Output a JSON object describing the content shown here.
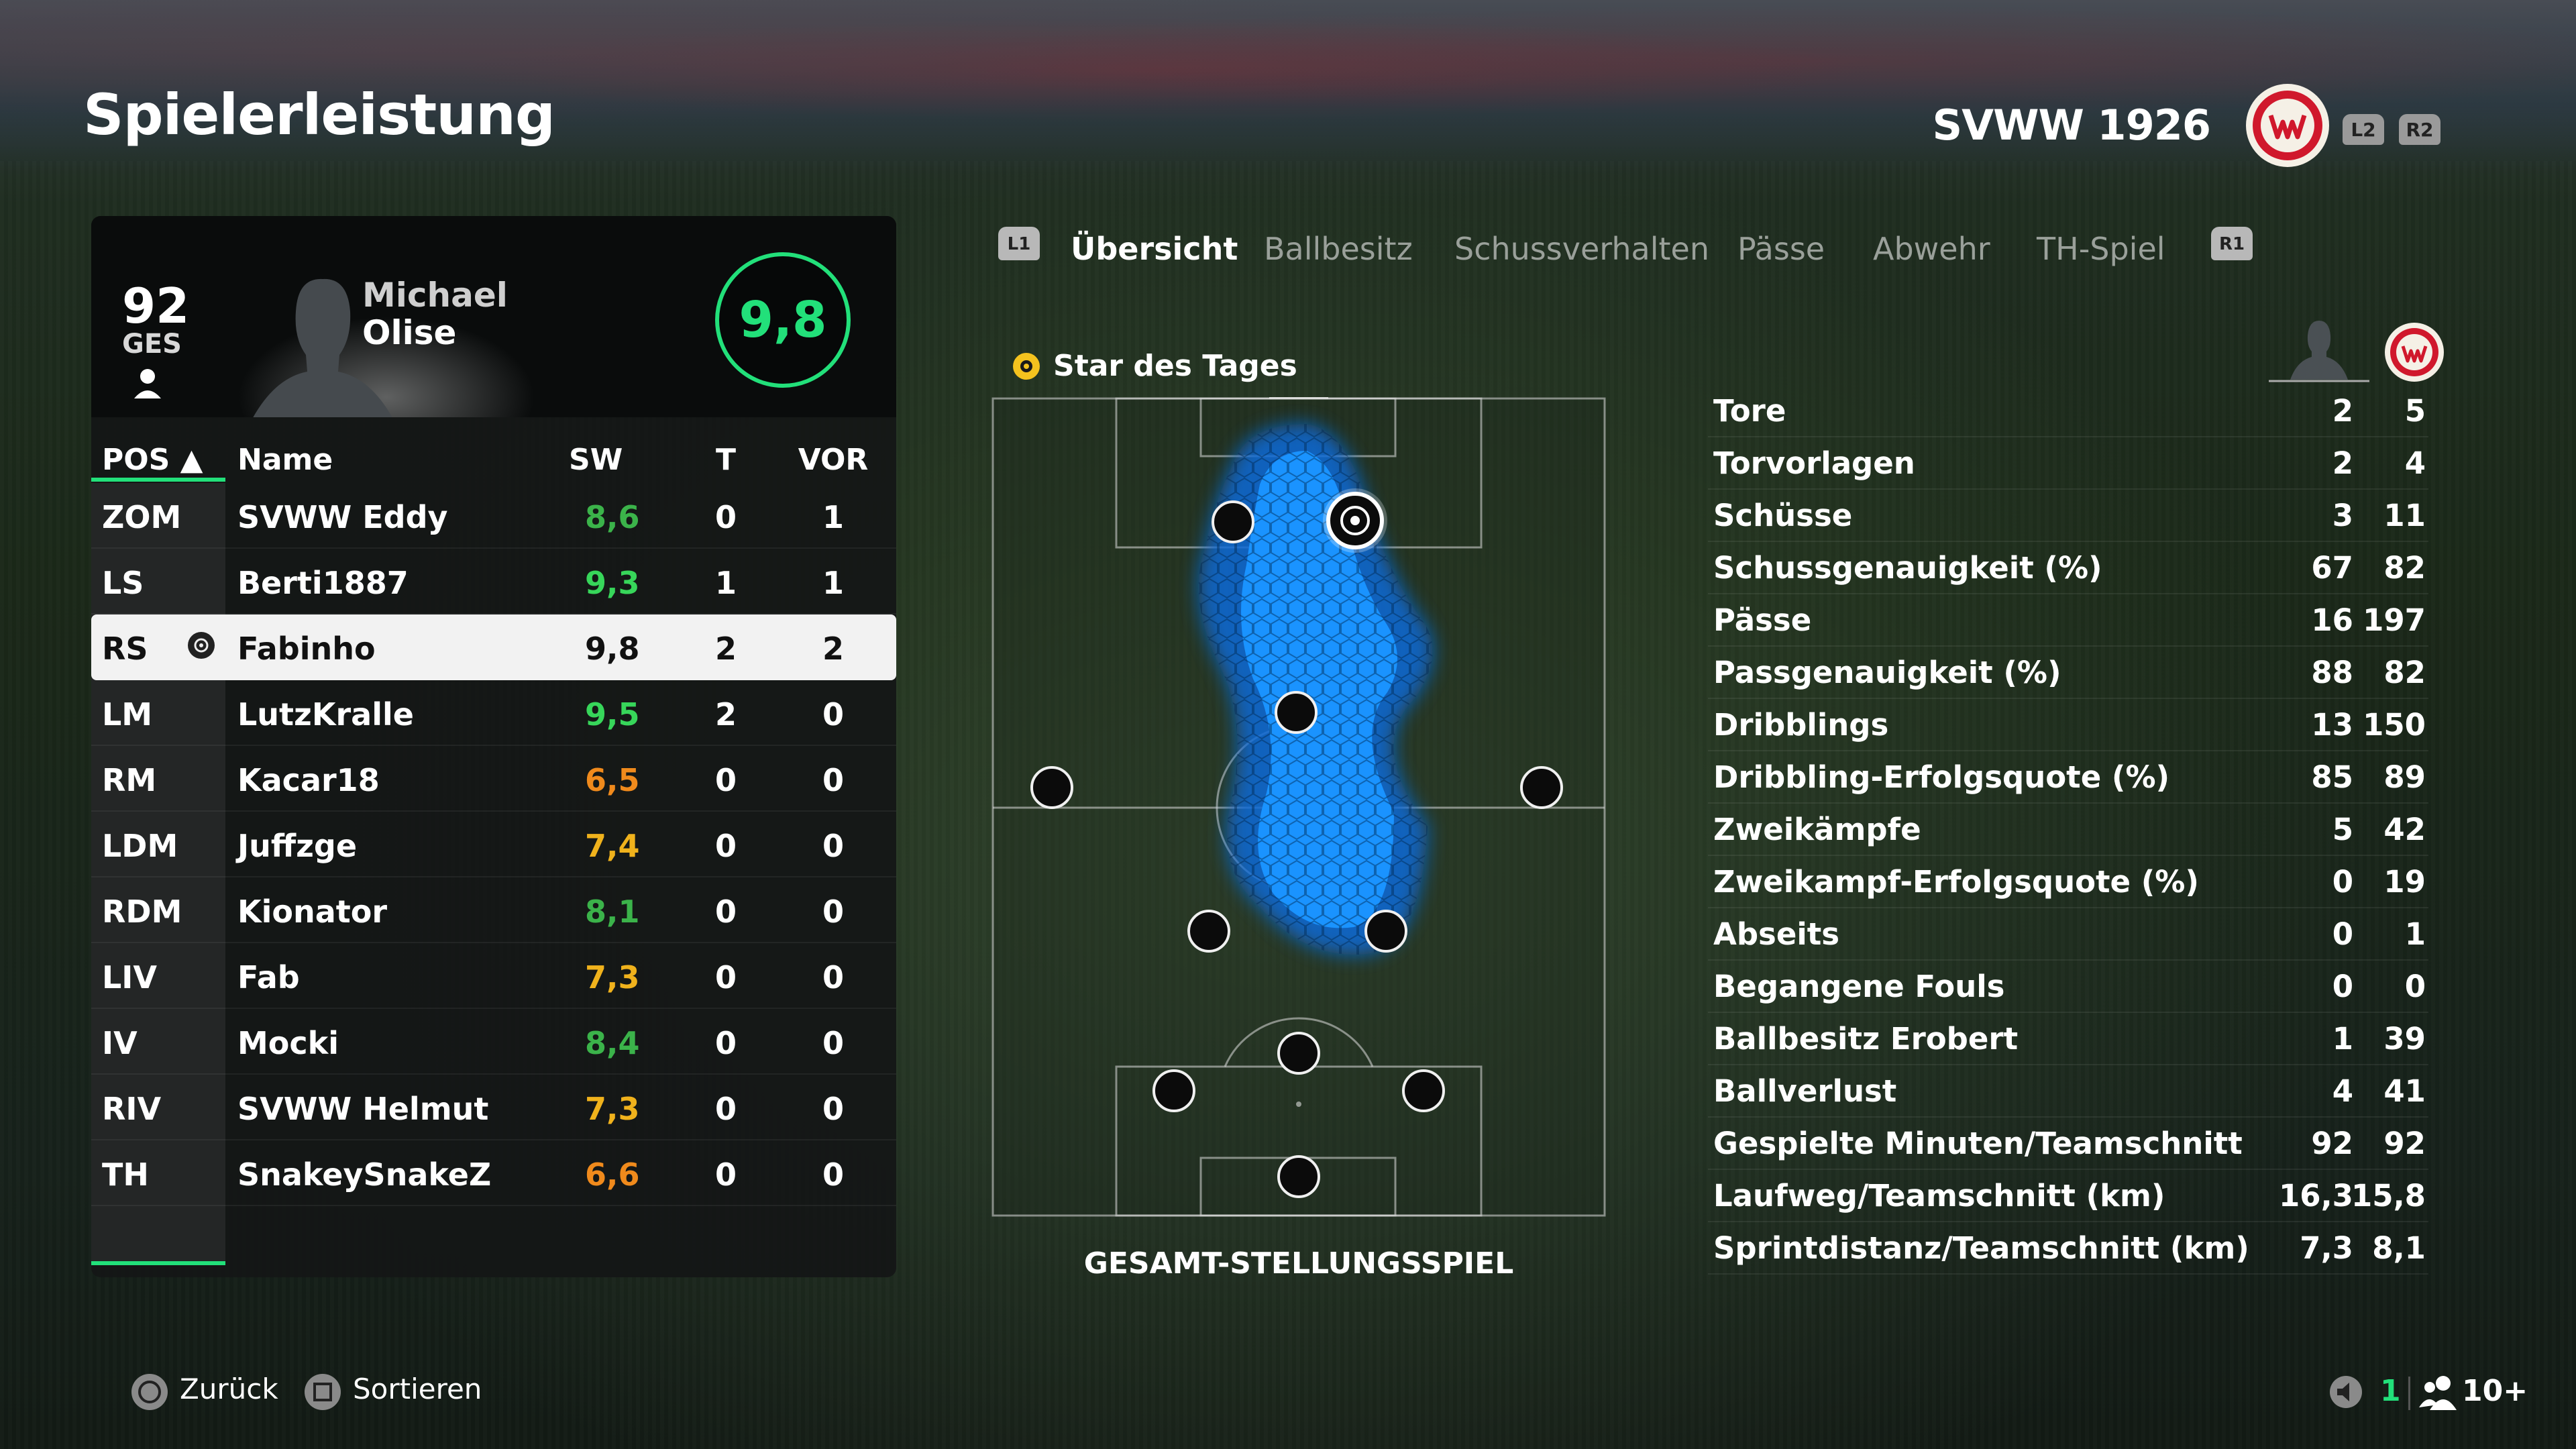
{
  "header": {
    "title": "Spielerleistung",
    "team_name": "SVWW 1926",
    "btn_l2": "L2",
    "btn_r2": "R2"
  },
  "player_card": {
    "overall": "92",
    "overall_label": "GES",
    "first_name": "Michael",
    "last_name": "Olise",
    "match_rating": "9,8",
    "rating_color": "#22e07a"
  },
  "table": {
    "headers": {
      "pos": "POS ▲",
      "name": "Name",
      "sw": "SW",
      "t": "T",
      "vor": "VOR"
    },
    "rows": [
      {
        "pos": "ZOM",
        "name": "SVWW Eddy",
        "sw": "8,6",
        "t": "0",
        "vor": "1",
        "sw_color": "#3bb34a"
      },
      {
        "pos": "LS",
        "name": "Berti1887",
        "sw": "9,3",
        "t": "1",
        "vor": "1",
        "sw_color": "#37d65a"
      },
      {
        "pos": "RS",
        "name": "Fabinho",
        "sw": "9,8",
        "t": "2",
        "vor": "2",
        "sw_color": "#111111"
      },
      {
        "pos": "LM",
        "name": "LutzKralle",
        "sw": "9,5",
        "t": "2",
        "vor": "0",
        "sw_color": "#37d65a"
      },
      {
        "pos": "RM",
        "name": "Kacar18",
        "sw": "6,5",
        "t": "0",
        "vor": "0",
        "sw_color": "#f08a1c"
      },
      {
        "pos": "LDM",
        "name": "Juffzge",
        "sw": "7,4",
        "t": "0",
        "vor": "0",
        "sw_color": "#f0b21c"
      },
      {
        "pos": "RDM",
        "name": "Kionator",
        "sw": "8,1",
        "t": "0",
        "vor": "0",
        "sw_color": "#3bb34a"
      },
      {
        "pos": "LIV",
        "name": "Fab",
        "sw": "7,3",
        "t": "0",
        "vor": "0",
        "sw_color": "#f0b21c"
      },
      {
        "pos": "IV",
        "name": "Mocki",
        "sw": "8,4",
        "t": "0",
        "vor": "0",
        "sw_color": "#3bb34a"
      },
      {
        "pos": "RIV",
        "name": "SVWW Helmut",
        "sw": "7,3",
        "t": "0",
        "vor": "0",
        "sw_color": "#f0b21c"
      },
      {
        "pos": "TH",
        "name": "SnakeySnakeZ",
        "sw": "6,6",
        "t": "0",
        "vor": "0",
        "sw_color": "#f08a1c"
      }
    ]
  },
  "tabs": {
    "left_btn": "L1",
    "right_btn": "R1",
    "items": [
      "Übersicht",
      "Ballbesitz",
      "Schussverhalten",
      "Pässe",
      "Abwehr",
      "TH-Spiel"
    ]
  },
  "star_label": "Star des Tages",
  "pitch_label": "GESAMT-STELLUNGSSPIEL",
  "stats": [
    {
      "label": "Tore",
      "player": "2",
      "team": "5"
    },
    {
      "label": "Torvorlagen",
      "player": "2",
      "team": "4"
    },
    {
      "label": "Schüsse",
      "player": "3",
      "team": "11"
    },
    {
      "label": "Schussgenauigkeit (%)",
      "player": "67",
      "team": "82"
    },
    {
      "label": "Pässe",
      "player": "16",
      "team": "197"
    },
    {
      "label": "Passgenauigkeit (%)",
      "player": "88",
      "team": "82"
    },
    {
      "label": "Dribblings",
      "player": "13",
      "team": "150"
    },
    {
      "label": "Dribbling-Erfolgsquote (%)",
      "player": "85",
      "team": "89"
    },
    {
      "label": "Zweikämpfe",
      "player": "5",
      "team": "42"
    },
    {
      "label": "Zweikampf-Erfolgsquote (%)",
      "player": "0",
      "team": "19"
    },
    {
      "label": "Abseits",
      "player": "0",
      "team": "1"
    },
    {
      "label": "Begangene Fouls",
      "player": "0",
      "team": "0"
    },
    {
      "label": "Ballbesitz Erobert",
      "player": "1",
      "team": "39"
    },
    {
      "label": "Ballverlust",
      "player": "4",
      "team": "41"
    },
    {
      "label": "Gespielte Minuten/Teamschnitt",
      "player": "92",
      "team": "92"
    },
    {
      "label": "Laufweg/Teamschnitt (km)",
      "player": "16,3",
      "team": "15,8"
    },
    {
      "label": "Sprintdistanz/Teamschnitt (km)",
      "player": "7,3",
      "team": "8,1"
    }
  ],
  "footer": {
    "back": "Zurück",
    "sort": "Sortieren",
    "count_a": "1",
    "count_b": "10+"
  },
  "colors": {
    "accent": "#22e07a",
    "heat": "#1a8fff",
    "crest_red": "#d0182c"
  }
}
